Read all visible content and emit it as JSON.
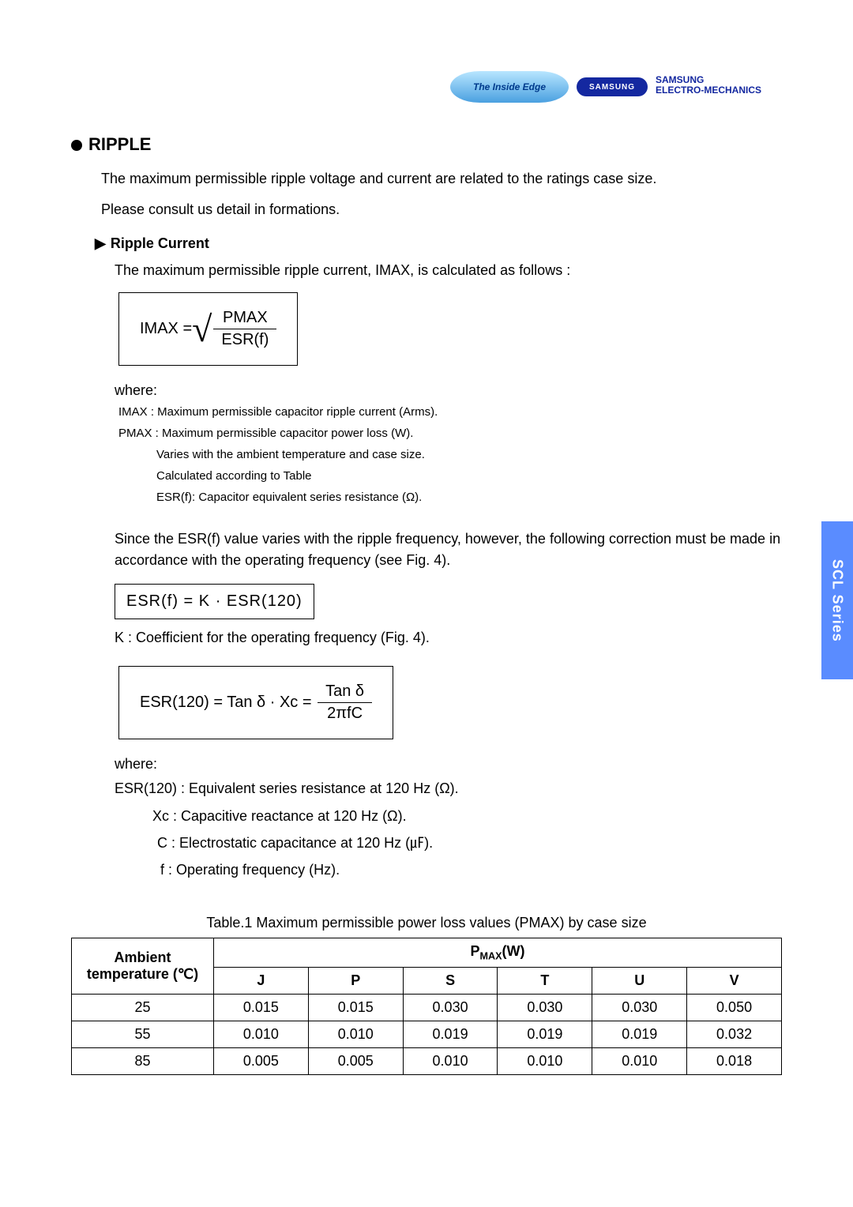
{
  "logos": {
    "inside_edge": "The Inside Edge",
    "samsung": "SAMSUNG",
    "sem_line1": "SAMSUNG",
    "sem_line2": "ELECTRO-MECHANICS"
  },
  "title": "RIPPLE",
  "intro1": "The maximum permissible ripple voltage and current are related to  the ratings case size.",
  "intro2": "Please consult us detail in formations.",
  "subheading1": "Ripple Current",
  "ripple_intro": "The maximum permissible ripple current, IMAX, is calculated as follows :",
  "formula_imax": {
    "lhs": "IMAX  = ",
    "num": "PMAX",
    "den": "ESR(f)"
  },
  "where": "where:",
  "defs": {
    "imax": "IMAX  : Maximum permissible capacitor ripple current (Arms).",
    "pmax": "PMAX : Maximum permissible capacitor power loss (W).",
    "pmax_note1": "Varies with the ambient temperature and case size.",
    "pmax_note2": "Calculated according to Table",
    "esrf": "ESR(f): Capacitor equivalent series resistance (Ω)."
  },
  "esr_corr": "Since the ESR(f) value varies with the ripple frequency, however, the following correction must be made in accordance with the operating frequency (see Fig. 4).",
  "esr_eq": "ESR(f)  =  K  · ESR(120)",
  "k_note": "K : Coefficient for the operating frequency (Fig. 4).",
  "esr120_eq": {
    "lhs": "ESR(120)  =  Tan δ · Xc  = ",
    "num": "Tan δ",
    "den": "2πfC"
  },
  "defs2": {
    "esr120": "ESR(120) : Equivalent series resistance at 120 Hz (Ω).",
    "xc": "Xc  : Capacitive reactance at 120 Hz (Ω).",
    "c": "C  : Electrostatic capacitance at 120 Hz (㎌).",
    "f": "f   : Operating frequency (Hz)."
  },
  "table_caption": "Table.1  Maximum permissible power loss values (PMAX) by case size",
  "sidebar": "SCL Series",
  "table": {
    "hdr_ambient": "Ambient\ntemperature (℃)",
    "hdr_pmax": "PMAX(W)",
    "cols": [
      "J",
      "P",
      "S",
      "T",
      "U",
      "V"
    ],
    "rows": [
      {
        "t": "25",
        "v": [
          "0.015",
          "0.015",
          "0.030",
          "0.030",
          "0.030",
          "0.050"
        ]
      },
      {
        "t": "55",
        "v": [
          "0.010",
          "0.010",
          "0.019",
          "0.019",
          "0.019",
          "0.032"
        ]
      },
      {
        "t": "85",
        "v": [
          "0.005",
          "0.005",
          "0.010",
          "0.010",
          "0.010",
          "0.018"
        ]
      }
    ]
  },
  "chart_data": {
    "type": "table",
    "title": "Maximum permissible power loss values (PMAX) by case size",
    "xlabel": "Case size",
    "ylabel": "PMAX (W)",
    "categories": [
      "J",
      "P",
      "S",
      "T",
      "U",
      "V"
    ],
    "series": [
      {
        "name": "25 ℃",
        "values": [
          0.015,
          0.015,
          0.03,
          0.03,
          0.03,
          0.05
        ]
      },
      {
        "name": "55 ℃",
        "values": [
          0.01,
          0.01,
          0.019,
          0.019,
          0.019,
          0.032
        ]
      },
      {
        "name": "85 ℃",
        "values": [
          0.005,
          0.005,
          0.01,
          0.01,
          0.01,
          0.018
        ]
      }
    ]
  }
}
